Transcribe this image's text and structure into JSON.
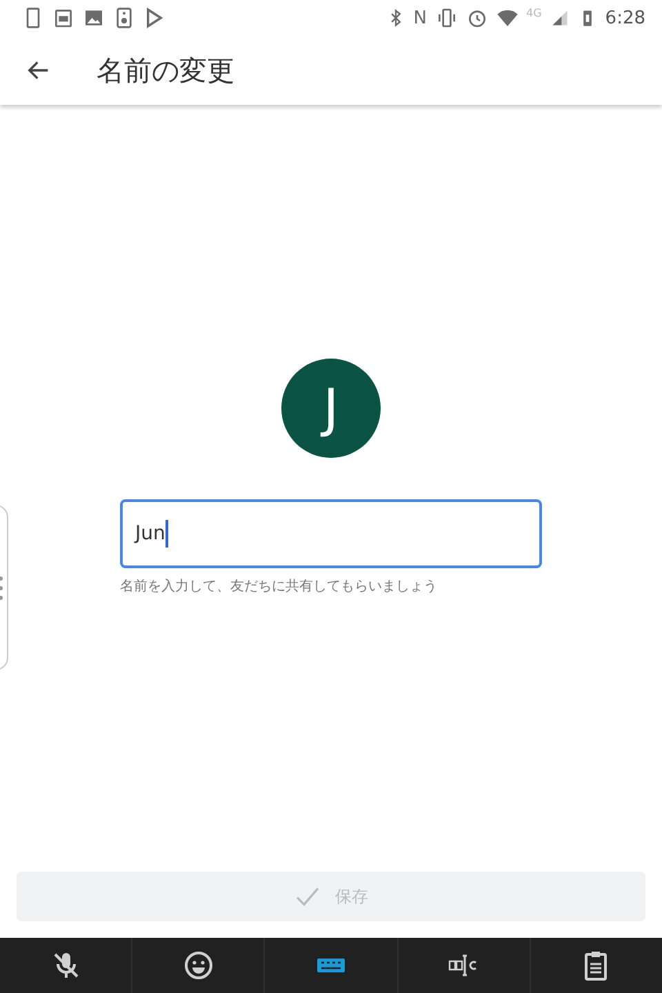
{
  "status_bar": {
    "nfc": "N",
    "network": "4G",
    "time": "6:28"
  },
  "app_bar": {
    "title": "名前の変更"
  },
  "avatar": {
    "initial": "J"
  },
  "name_field": {
    "value": "Jun",
    "focused": true,
    "helper": "名前を入力して、友だちに共有してもらいましょう"
  },
  "save_button": {
    "label": "保存",
    "disabled": true
  },
  "keyboard_toolbar": [
    {
      "kind": "mic-off",
      "selected": false
    },
    {
      "kind": "emoji",
      "selected": false
    },
    {
      "kind": "keyboard",
      "selected": true
    },
    {
      "kind": "text-select",
      "selected": false
    },
    {
      "kind": "clipboard",
      "selected": false
    }
  ]
}
